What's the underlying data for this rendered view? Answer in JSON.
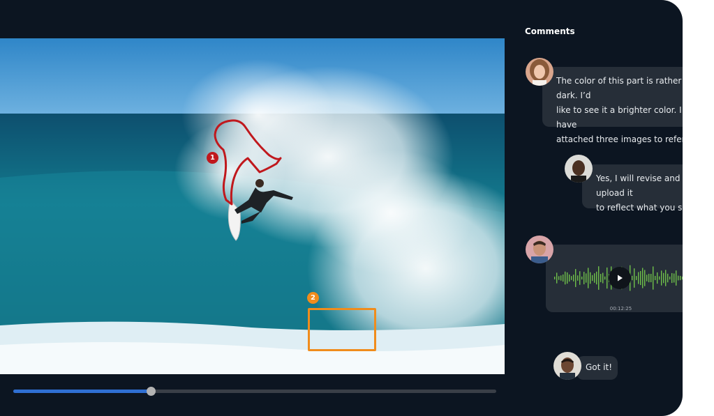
{
  "video": {
    "annotations": [
      {
        "number": "1",
        "color": "#c0181d",
        "shape": "freehand-outline"
      },
      {
        "number": "2",
        "color": "#f08c1c",
        "shape": "rectangle"
      }
    ],
    "progress": 0.284,
    "colors": {
      "progress_fill": "#2f6fd3",
      "track": "#3a3f47"
    }
  },
  "comments": {
    "title": "Comments",
    "items": [
      {
        "type": "text",
        "avatar": "woman-avatar",
        "lines": [
          "The color of this part is rather dark. I’d",
          "like to see it a brighter color. I have",
          "attached three images to refer to."
        ]
      },
      {
        "type": "text",
        "avatar": "man-avatar",
        "lines": [
          "Yes, I will revise and upload it",
          "to reflect what you said."
        ]
      },
      {
        "type": "voice",
        "avatar": "man-avatar",
        "duration": "00:12:25",
        "waveform_color": "#6fc04a"
      },
      {
        "type": "text",
        "avatar": "man-avatar",
        "lines": [
          "Got it!"
        ]
      }
    ]
  }
}
